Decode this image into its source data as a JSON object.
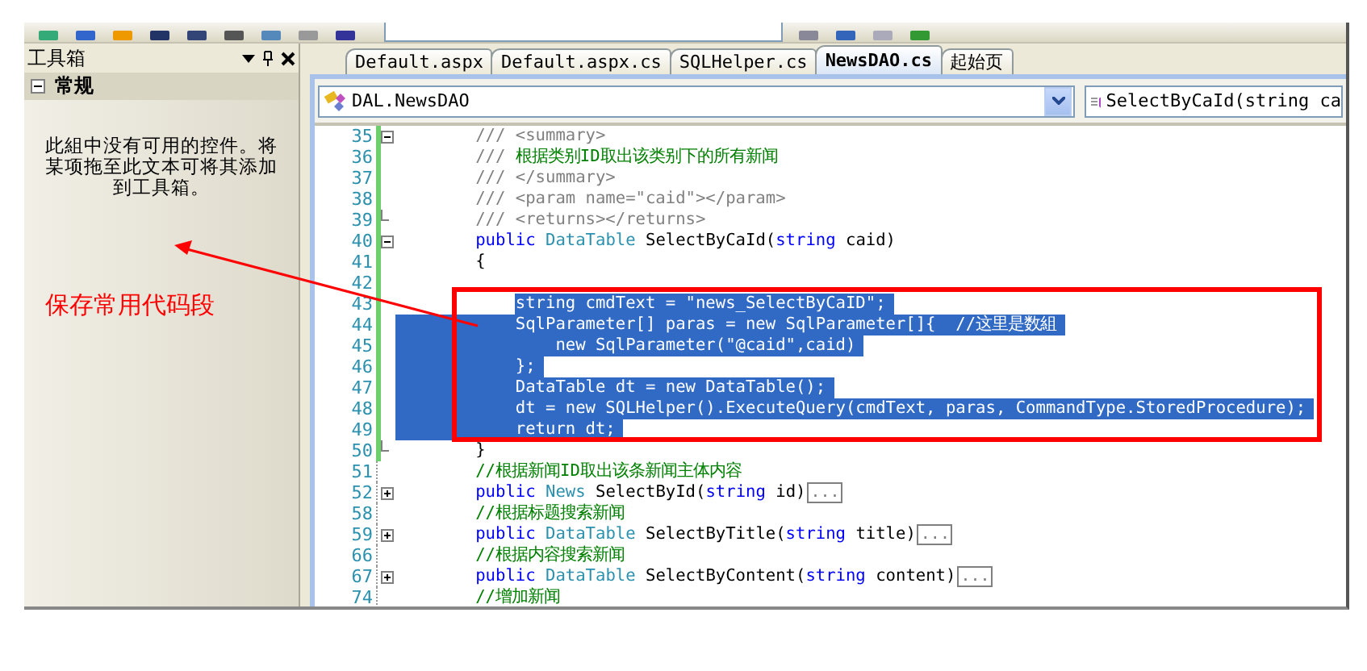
{
  "toolbox": {
    "title": "工具箱",
    "section": {
      "label": "常规",
      "expanded": true
    },
    "message": "此組中没有可用的控件。将某项拖至此文本可将其添加到工具箱。"
  },
  "tabs": [
    {
      "label": "Default.aspx",
      "selected": false
    },
    {
      "label": "Default.aspx.cs",
      "selected": false
    },
    {
      "label": "SQLHelper.cs",
      "selected": false
    },
    {
      "label": "NewsDAO.cs",
      "selected": true
    },
    {
      "label": "起始页",
      "selected": false
    }
  ],
  "nav": {
    "class_dropdown": "DAL.NewsDAO",
    "member_dropdown": "SelectByCaId(string ca"
  },
  "code_lines": [
    {
      "number": "35",
      "fold": {
        "kind": "collapse"
      },
      "changed": true,
      "selected": false,
      "tokens": [
        {
          "text": "        /// <summary>",
          "kind": "doc"
        }
      ]
    },
    {
      "number": "36",
      "changed": true,
      "selected": false,
      "tokens": [
        {
          "text": "        /// ",
          "kind": "doc"
        },
        {
          "text": "根据类别ID取出该类别下的所有新闻",
          "kind": "comment"
        }
      ]
    },
    {
      "number": "37",
      "changed": true,
      "selected": false,
      "tokens": [
        {
          "text": "        /// </summary>",
          "kind": "doc"
        }
      ]
    },
    {
      "number": "38",
      "changed": true,
      "selected": false,
      "tokens": [
        {
          "text": "        /// <param name=\"caid\"></param>",
          "kind": "doc"
        }
      ]
    },
    {
      "number": "39",
      "fold": {
        "kind": "end"
      },
      "changed": true,
      "selected": false,
      "tokens": [
        {
          "text": "        /// <returns></returns>",
          "kind": "doc"
        }
      ]
    },
    {
      "number": "40",
      "fold": {
        "kind": "collapse"
      },
      "changed": true,
      "selected": false,
      "tokens": [
        {
          "text": "        public ",
          "kind": "keyword"
        },
        {
          "text": "DataTable",
          "kind": "type"
        },
        {
          "text": " SelectByCaId(",
          "kind": "plain"
        },
        {
          "text": "string",
          "kind": "keyword"
        },
        {
          "text": " caid)",
          "kind": "plain"
        }
      ]
    },
    {
      "number": "41",
      "changed": true,
      "selected": false,
      "tokens": [
        {
          "text": "        {",
          "kind": "plain"
        }
      ]
    },
    {
      "number": "42",
      "changed": true
    },
    {
      "number": "43",
      "changed": true,
      "selected": true,
      "selection_from_margin": false,
      "tokens": [
        {
          "text": "            string cmdText = \"news_SelectByCaID\";",
          "kind": "plain"
        }
      ]
    },
    {
      "number": "44",
      "changed": true,
      "selected": true,
      "selection_from_margin": true,
      "tokens": [
        {
          "text": "            SqlParameter[] paras = new SqlParameter[]{  //这里是数組",
          "kind": "plain"
        }
      ]
    },
    {
      "number": "45",
      "changed": true,
      "selected": true,
      "selection_from_margin": true,
      "tokens": [
        {
          "text": "                new SqlParameter(\"@caid\",caid)",
          "kind": "plain"
        }
      ]
    },
    {
      "number": "46",
      "changed": true,
      "selected": true,
      "selection_from_margin": true,
      "tokens": [
        {
          "text": "            };",
          "kind": "plain"
        }
      ]
    },
    {
      "number": "47",
      "changed": true,
      "selected": true,
      "selection_from_margin": true,
      "tokens": [
        {
          "text": "            DataTable dt = new DataTable();",
          "kind": "plain"
        }
      ]
    },
    {
      "number": "48",
      "changed": true,
      "selected": true,
      "selection_from_margin": true,
      "tokens": [
        {
          "text": "            dt = new SQLHelper().ExecuteQuery(cmdText, paras, CommandType.StoredProcedure);",
          "kind": "plain"
        }
      ]
    },
    {
      "number": "49",
      "changed": true,
      "selected": true,
      "selection_from_margin": true,
      "tokens": [
        {
          "text": "            return dt;",
          "kind": "plain"
        }
      ]
    },
    {
      "number": "50",
      "fold": {
        "kind": "end"
      },
      "changed": true,
      "selected": false,
      "tokens": [
        {
          "text": "        }",
          "kind": "plain"
        }
      ]
    },
    {
      "number": "51",
      "changed": false,
      "selected": false,
      "tokens": [
        {
          "text": "        //根据新闻ID取出该条新闻主体内容",
          "kind": "comment"
        }
      ]
    },
    {
      "number": "52",
      "fold": {
        "kind": "expand"
      },
      "changed": false,
      "selected": false,
      "tokens": [
        {
          "text": "        public ",
          "kind": "keyword"
        },
        {
          "text": "News",
          "kind": "type"
        },
        {
          "text": " SelectById(",
          "kind": "plain"
        },
        {
          "text": "string",
          "kind": "keyword"
        },
        {
          "text": " id)",
          "kind": "plain"
        },
        {
          "text": "...",
          "kind": "collapsed"
        }
      ]
    },
    {
      "number": "58",
      "changed": false,
      "selected": false,
      "tokens": [
        {
          "text": "        //根据标题搜索新闻",
          "kind": "comment"
        }
      ]
    },
    {
      "number": "59",
      "fold": {
        "kind": "expand"
      },
      "changed": false,
      "selected": false,
      "tokens": [
        {
          "text": "        public ",
          "kind": "keyword"
        },
        {
          "text": "DataTable",
          "kind": "type"
        },
        {
          "text": " SelectByTitle(",
          "kind": "plain"
        },
        {
          "text": "string",
          "kind": "keyword"
        },
        {
          "text": " title)",
          "kind": "plain"
        },
        {
          "text": "...",
          "kind": "collapsed"
        }
      ]
    },
    {
      "number": "66",
      "changed": false,
      "selected": false,
      "tokens": [
        {
          "text": "        //根据内容搜索新闻",
          "kind": "comment"
        }
      ]
    },
    {
      "number": "67",
      "fold": {
        "kind": "expand"
      },
      "changed": false,
      "selected": false,
      "tokens": [
        {
          "text": "        public ",
          "kind": "keyword"
        },
        {
          "text": "DataTable",
          "kind": "type"
        },
        {
          "text": " SelectByContent(",
          "kind": "plain"
        },
        {
          "text": "string",
          "kind": "keyword"
        },
        {
          "text": " content)",
          "kind": "plain"
        },
        {
          "text": "...",
          "kind": "collapsed"
        }
      ]
    },
    {
      "number": "74",
      "changed": false,
      "selected": false,
      "tokens": [
        {
          "text": "        //增加新闻",
          "kind": "comment"
        }
      ]
    }
  ],
  "annotation": {
    "text": "保存常用代码段"
  }
}
